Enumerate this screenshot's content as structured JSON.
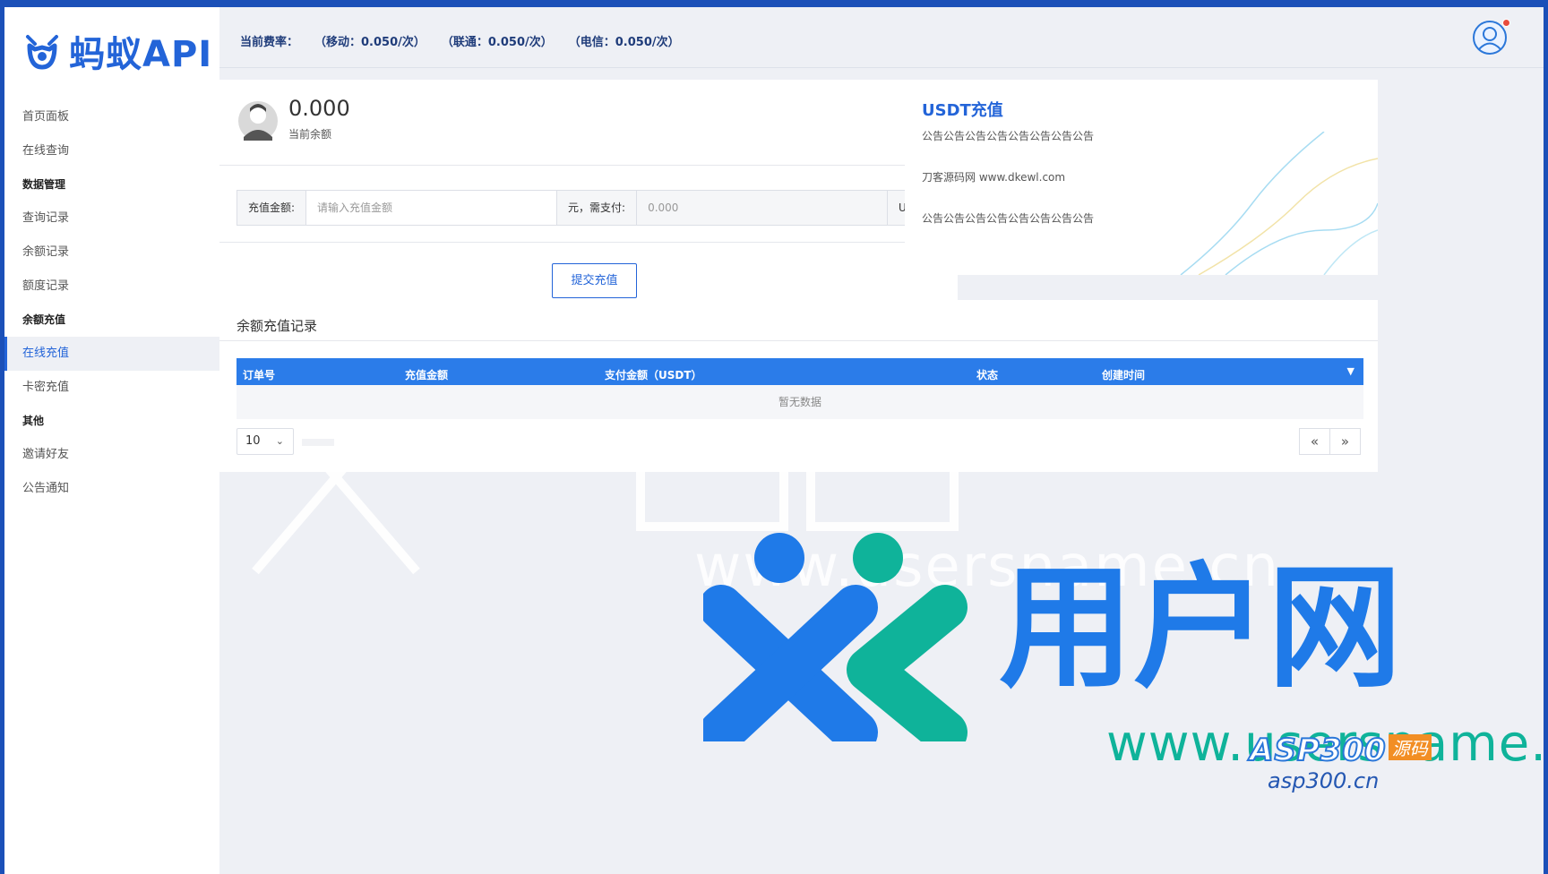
{
  "brand": {
    "name": "蚂蚁API",
    "color": "#2364d8"
  },
  "topbar": {
    "rate_label": "当前费率：",
    "rates": [
      "（移动：0.050/次）",
      "（联通：0.050/次）",
      "（电信：0.050/次）"
    ]
  },
  "sidebar": {
    "items": [
      {
        "label": "首页面板"
      },
      {
        "label": "在线查询"
      }
    ],
    "groups": [
      {
        "title": "数据管理",
        "items": [
          "查询记录",
          "余额记录",
          "额度记录"
        ]
      },
      {
        "title": "余额充值",
        "items": [
          "在线充值",
          "卡密充值"
        ]
      },
      {
        "title": "其他",
        "items": [
          "邀请好友",
          "公告通知"
        ]
      }
    ],
    "active": "在线充值"
  },
  "balance": {
    "value": "0.000",
    "label": "当前余额"
  },
  "recharge_form": {
    "amount_label": "充值金额:",
    "amount_placeholder": "请输入充值金额",
    "pay_label": "元，需支付:",
    "pay_placeholder": "0.000",
    "unit": "USDT",
    "submit_label": "提交充值"
  },
  "usdt_panel": {
    "title": "USDT充值",
    "notices": [
      "公告公告公告公告公告公告公告公告",
      "刀客源码网 www.dkewl.com",
      "公告公告公告公告公告公告公告公告"
    ]
  },
  "records": {
    "title": "余额充值记录",
    "columns": [
      "订单号",
      "充值金额",
      "支付金额（USDT）",
      "状态",
      "创建时间"
    ],
    "empty_text": "暂无数据",
    "page_size": "10",
    "prev_label": "«",
    "next_label": "»"
  },
  "watermark": {
    "brand_cn": "用户网",
    "site": "www.usersname.cn",
    "asp_main": "ASP300",
    "asp_tag": "源码",
    "asp_site": "asp300.cn",
    "colors": {
      "blue": "#1f7ae8",
      "teal": "#0fb39a"
    }
  }
}
